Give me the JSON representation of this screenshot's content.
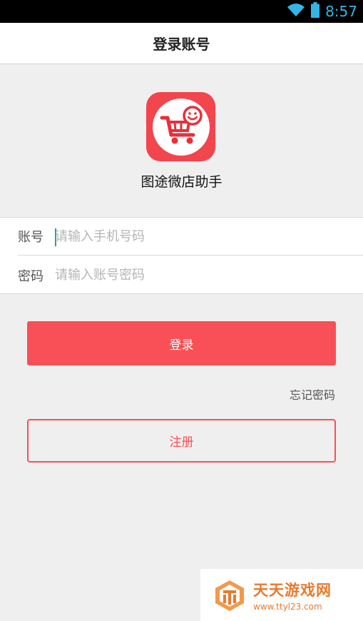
{
  "status_bar": {
    "time": "8:57",
    "icons": [
      "wifi-icon",
      "battery-icon"
    ],
    "accent_color": "#33b5e5"
  },
  "header": {
    "title": "登录账号"
  },
  "app": {
    "name": "图途微店助手",
    "logo_icon": "shopping-cart-smiley-icon",
    "brand_color": "#f2454e"
  },
  "form": {
    "account_label": "账号",
    "account_placeholder": "请输入手机号码",
    "account_value": "",
    "password_label": "密码",
    "password_placeholder": "请输入账号密码",
    "password_value": ""
  },
  "actions": {
    "login_label": "登录",
    "forgot_label": "忘记密码",
    "register_label": "注册",
    "button_color": "#f85056"
  },
  "watermark": {
    "title": "天天游戏网",
    "url": "www.ttyl23.com"
  }
}
